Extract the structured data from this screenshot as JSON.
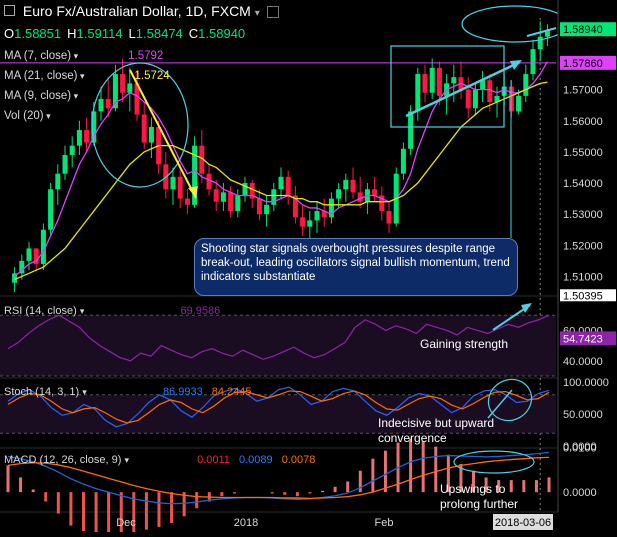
{
  "header": {
    "title": "Euro Fx/Australian Dollar, 1D, FXCM",
    "ohlc": [
      {
        "k": "O",
        "v": "1.58851"
      },
      {
        "k": "H",
        "v": "1.59114"
      },
      {
        "k": "L",
        "v": "1.58474"
      },
      {
        "k": "C",
        "v": "1.58940"
      }
    ],
    "indicators": [
      {
        "label": "MA (7, close)",
        "value": "1.5792",
        "color": "#e040fb"
      },
      {
        "label": "MA (21, close)",
        "value": "1.5724",
        "color": "#ffeb3b"
      },
      {
        "label": "MA (9, close)",
        "value": "",
        "color": "#29b6f6"
      },
      {
        "label": "Vol (20)",
        "value": "",
        "color": "#9e9e9e"
      }
    ]
  },
  "colors": {
    "up": "#00e676",
    "down": "#ff1744",
    "ma7": "#e040fb",
    "ma21": "#e6e600",
    "ma9": "#29b6f6",
    "annotation": "#4dd0e1",
    "callout_bg": "#0d2b66",
    "rsi": "#8e24aa",
    "stoch_k": "#2962ff",
    "stoch_d": "#ff6d00",
    "macd": "#1e63d6",
    "signal": "#ff6d00",
    "hist_up": "#e57373",
    "hist_down": "#ef5350"
  },
  "price_axis": {
    "ticks": [
      "1.58940",
      "1.57860",
      "1.57000",
      "1.56000",
      "1.55000",
      "1.54000",
      "1.53000",
      "1.52000",
      "1.51000",
      "1.50395"
    ],
    "current": "1.58940",
    "ma_level": "1.57860"
  },
  "time_axis": {
    "labels": [
      "Dec",
      "2018",
      "Feb",
      "2018-03-06"
    ]
  },
  "callout": {
    "text": "Shooting star signals overbought pressures despite range break-out, leading oscillators signal bullish momentum, trend indicators substantiate"
  },
  "rsi_panel": {
    "label": "RSI (14, close)",
    "value": "69.9586",
    "current_tag": "54.7423",
    "axis": [
      "60.0000",
      "40.0000"
    ],
    "note": "Gaining strength"
  },
  "stoch_panel": {
    "label": "Stoch (14, 3, 1)",
    "k_value": "86.9933",
    "d_value": "84.2445",
    "axis": [
      "100.0000",
      "50.0000",
      "0.0000"
    ],
    "note": "Indecisive but upward convergence"
  },
  "macd_panel": {
    "label": "MACD (12, 26, close, 9)",
    "hist_value": "0.0011",
    "macd_value": "0.0089",
    "signal_value": "0.0078",
    "axis": [
      "0.0100",
      "0.0000"
    ],
    "note": "Upswings to prolong further"
  },
  "chart_data": {
    "type": "candlestick",
    "ylim": [
      1.505,
      1.593
    ],
    "candles": [
      [
        1.508,
        1.513,
        1.505,
        1.511
      ],
      [
        1.511,
        1.517,
        1.509,
        1.515
      ],
      [
        1.515,
        1.521,
        1.512,
        1.519
      ],
      [
        1.519,
        1.518,
        1.512,
        1.514
      ],
      [
        1.514,
        1.527,
        1.512,
        1.525
      ],
      [
        1.525,
        1.54,
        1.523,
        1.538
      ],
      [
        1.538,
        1.546,
        1.533,
        1.543
      ],
      [
        1.543,
        1.552,
        1.541,
        1.549
      ],
      [
        1.549,
        1.555,
        1.545,
        1.552
      ],
      [
        1.552,
        1.56,
        1.549,
        1.557
      ],
      [
        1.557,
        1.561,
        1.55,
        1.553
      ],
      [
        1.553,
        1.566,
        1.552,
        1.563
      ],
      [
        1.563,
        1.571,
        1.56,
        1.567
      ],
      [
        1.567,
        1.574,
        1.561,
        1.564
      ],
      [
        1.564,
        1.578,
        1.563,
        1.575
      ],
      [
        1.575,
        1.58,
        1.566,
        1.569
      ],
      [
        1.569,
        1.577,
        1.563,
        1.572
      ],
      [
        1.572,
        1.576,
        1.56,
        1.562
      ],
      [
        1.562,
        1.566,
        1.551,
        1.553
      ],
      [
        1.553,
        1.561,
        1.548,
        1.558
      ],
      [
        1.558,
        1.56,
        1.543,
        1.546
      ],
      [
        1.546,
        1.55,
        1.535,
        1.538
      ],
      [
        1.538,
        1.545,
        1.533,
        1.542
      ],
      [
        1.542,
        1.546,
        1.532,
        1.535
      ],
      [
        1.535,
        1.538,
        1.53,
        1.533
      ],
      [
        1.533,
        1.555,
        1.532,
        1.552
      ],
      [
        1.552,
        1.557,
        1.54,
        1.543
      ],
      [
        1.543,
        1.546,
        1.536,
        1.538
      ],
      [
        1.538,
        1.541,
        1.531,
        1.534
      ],
      [
        1.534,
        1.54,
        1.531,
        1.537
      ],
      [
        1.537,
        1.539,
        1.529,
        1.531
      ],
      [
        1.531,
        1.538,
        1.529,
        1.536
      ],
      [
        1.536,
        1.542,
        1.534,
        1.54
      ],
      [
        1.54,
        1.541,
        1.532,
        1.535
      ],
      [
        1.535,
        1.538,
        1.528,
        1.53
      ],
      [
        1.53,
        1.536,
        1.526,
        1.533
      ],
      [
        1.533,
        1.54,
        1.531,
        1.538
      ],
      [
        1.538,
        1.545,
        1.535,
        1.542
      ],
      [
        1.542,
        1.544,
        1.533,
        1.536
      ],
      [
        1.536,
        1.539,
        1.527,
        1.529
      ],
      [
        1.529,
        1.533,
        1.523,
        1.526
      ],
      [
        1.526,
        1.531,
        1.519,
        1.528
      ],
      [
        1.528,
        1.534,
        1.524,
        1.531
      ],
      [
        1.531,
        1.535,
        1.526,
        1.529
      ],
      [
        1.529,
        1.537,
        1.527,
        1.535
      ],
      [
        1.535,
        1.54,
        1.532,
        1.538
      ],
      [
        1.538,
        1.543,
        1.534,
        1.541
      ],
      [
        1.541,
        1.545,
        1.535,
        1.537
      ],
      [
        1.537,
        1.542,
        1.532,
        1.534
      ],
      [
        1.534,
        1.54,
        1.53,
        1.538
      ],
      [
        1.538,
        1.542,
        1.534,
        1.536
      ],
      [
        1.536,
        1.539,
        1.528,
        1.531
      ],
      [
        1.531,
        1.534,
        1.524,
        1.527
      ],
      [
        1.527,
        1.545,
        1.526,
        1.543
      ],
      [
        1.543,
        1.553,
        1.541,
        1.551
      ],
      [
        1.551,
        1.565,
        1.549,
        1.563
      ],
      [
        1.563,
        1.577,
        1.56,
        1.575
      ],
      [
        1.575,
        1.578,
        1.566,
        1.569
      ],
      [
        1.569,
        1.58,
        1.567,
        1.577
      ],
      [
        1.577,
        1.579,
        1.565,
        1.568
      ],
      [
        1.568,
        1.575,
        1.562,
        1.572
      ],
      [
        1.572,
        1.578,
        1.566,
        1.574
      ],
      [
        1.574,
        1.579,
        1.567,
        1.57
      ],
      [
        1.57,
        1.574,
        1.561,
        1.564
      ],
      [
        1.564,
        1.572,
        1.562,
        1.57
      ],
      [
        1.57,
        1.576,
        1.566,
        1.573
      ],
      [
        1.573,
        1.575,
        1.563,
        1.566
      ],
      [
        1.566,
        1.571,
        1.561,
        1.568
      ],
      [
        1.568,
        1.575,
        1.565,
        1.571
      ],
      [
        1.571,
        1.573,
        1.561,
        1.563
      ],
      [
        1.563,
        1.57,
        1.562,
        1.568
      ],
      [
        1.568,
        1.578,
        1.566,
        1.575
      ],
      [
        1.575,
        1.586,
        1.573,
        1.583
      ],
      [
        1.583,
        1.592,
        1.579,
        1.587
      ],
      [
        1.587,
        1.591,
        1.584,
        1.589
      ]
    ],
    "series": [
      {
        "name": "MA (7, close)",
        "values": [
          1.51,
          1.512,
          1.514,
          1.515,
          1.518,
          1.523,
          1.528,
          1.534,
          1.54,
          1.546,
          1.55,
          1.555,
          1.559,
          1.562,
          1.566,
          1.567,
          1.569,
          1.568,
          1.566,
          1.564,
          1.561,
          1.557,
          1.552,
          1.547,
          1.543,
          1.544,
          1.542,
          1.541,
          1.54,
          1.538,
          1.537,
          1.536,
          1.536,
          1.536,
          1.535,
          1.534,
          1.534,
          1.535,
          1.536,
          1.535,
          1.533,
          1.532,
          1.532,
          1.531,
          1.53,
          1.532,
          1.533,
          1.534,
          1.535,
          1.536,
          1.536,
          1.535,
          1.534,
          1.535,
          1.538,
          1.543,
          1.551,
          1.557,
          1.563,
          1.567,
          1.57,
          1.571,
          1.572,
          1.571,
          1.57,
          1.57,
          1.57,
          1.569,
          1.57,
          1.569,
          1.569,
          1.57,
          1.572,
          1.575,
          1.579
        ]
      },
      {
        "name": "MA (21, close)",
        "values": [
          1.509,
          1.51,
          1.511,
          1.512,
          1.513,
          1.515,
          1.517,
          1.519,
          1.522,
          1.525,
          1.528,
          1.531,
          1.534,
          1.537,
          1.54,
          1.543,
          1.546,
          1.548,
          1.55,
          1.551,
          1.552,
          1.552,
          1.552,
          1.551,
          1.55,
          1.549,
          1.548,
          1.546,
          1.545,
          1.543,
          1.541,
          1.54,
          1.539,
          1.538,
          1.537,
          1.536,
          1.536,
          1.536,
          1.536,
          1.535,
          1.535,
          1.534,
          1.534,
          1.533,
          1.533,
          1.533,
          1.533,
          1.533,
          1.533,
          1.534,
          1.534,
          1.534,
          1.534,
          1.535,
          1.536,
          1.538,
          1.54,
          1.543,
          1.546,
          1.549,
          1.552,
          1.555,
          1.558,
          1.56,
          1.562,
          1.564,
          1.565,
          1.566,
          1.567,
          1.568,
          1.569,
          1.57,
          1.571,
          1.572,
          1.5724
        ]
      }
    ],
    "rsi": [
      48,
      52,
      58,
      63,
      67,
      70,
      66,
      62,
      55,
      50,
      46,
      42,
      40,
      45,
      43,
      50,
      47,
      44,
      42,
      46,
      48,
      45,
      43,
      47,
      44,
      41,
      43,
      46,
      49,
      45,
      42,
      44,
      48,
      52,
      62,
      67,
      64,
      60,
      63,
      61,
      58,
      64,
      62,
      60,
      57,
      62,
      60,
      58,
      61,
      64,
      62,
      65,
      67,
      70
    ],
    "stoch_k": [
      70,
      82,
      88,
      78,
      60,
      48,
      52,
      65,
      58,
      40,
      30,
      35,
      50,
      68,
      80,
      72,
      55,
      45,
      60,
      78,
      85,
      90,
      82,
      70,
      75,
      88,
      92,
      80,
      65,
      70,
      85,
      90,
      86,
      70,
      55,
      48,
      60,
      75,
      82,
      78,
      65,
      52,
      60,
      78,
      86,
      88,
      80,
      68,
      70,
      82,
      87
    ],
    "stoch_d": [
      65,
      75,
      82,
      80,
      70,
      58,
      52,
      58,
      60,
      52,
      42,
      36,
      40,
      52,
      65,
      72,
      68,
      58,
      52,
      62,
      75,
      84,
      85,
      80,
      75,
      80,
      86,
      85,
      78,
      70,
      74,
      82,
      86,
      80,
      68,
      58,
      56,
      65,
      74,
      78,
      74,
      64,
      58,
      66,
      76,
      84,
      85,
      79,
      72,
      74,
      84
    ],
    "macd": [
      0.008,
      0.0075,
      0.0068,
      0.0058,
      0.0045,
      0.003,
      0.0018,
      0.0008,
      0.0,
      -0.0008,
      -0.0015,
      -0.002,
      -0.0024,
      -0.0026,
      -0.0025,
      -0.0022,
      -0.0018,
      -0.0015,
      -0.0013,
      -0.0012,
      -0.0012,
      -0.0013,
      -0.0015,
      -0.0016,
      -0.0015,
      -0.0012,
      -0.0008,
      -0.0002,
      0.001,
      0.0025,
      0.004,
      0.0055,
      0.0068,
      0.0076,
      0.008,
      0.0082,
      0.0081,
      0.008,
      0.0079,
      0.008,
      0.0082,
      0.0084,
      0.0086,
      0.0089
    ],
    "signal": [
      0.006,
      0.0064,
      0.0066,
      0.0065,
      0.0061,
      0.0055,
      0.0047,
      0.0039,
      0.0031,
      0.0023,
      0.0015,
      0.0008,
      0.0002,
      -0.0003,
      -0.0007,
      -0.001,
      -0.0011,
      -0.0012,
      -0.0012,
      -0.0012,
      -0.0012,
      -0.0012,
      -0.0013,
      -0.0013,
      -0.0014,
      -0.0013,
      -0.0012,
      -0.001,
      -0.0006,
      0.0,
      0.0009,
      0.0018,
      0.0028,
      0.0038,
      0.0046,
      0.0054,
      0.006,
      0.0064,
      0.0068,
      0.0071,
      0.0073,
      0.0075,
      0.0077,
      0.0078
    ]
  }
}
